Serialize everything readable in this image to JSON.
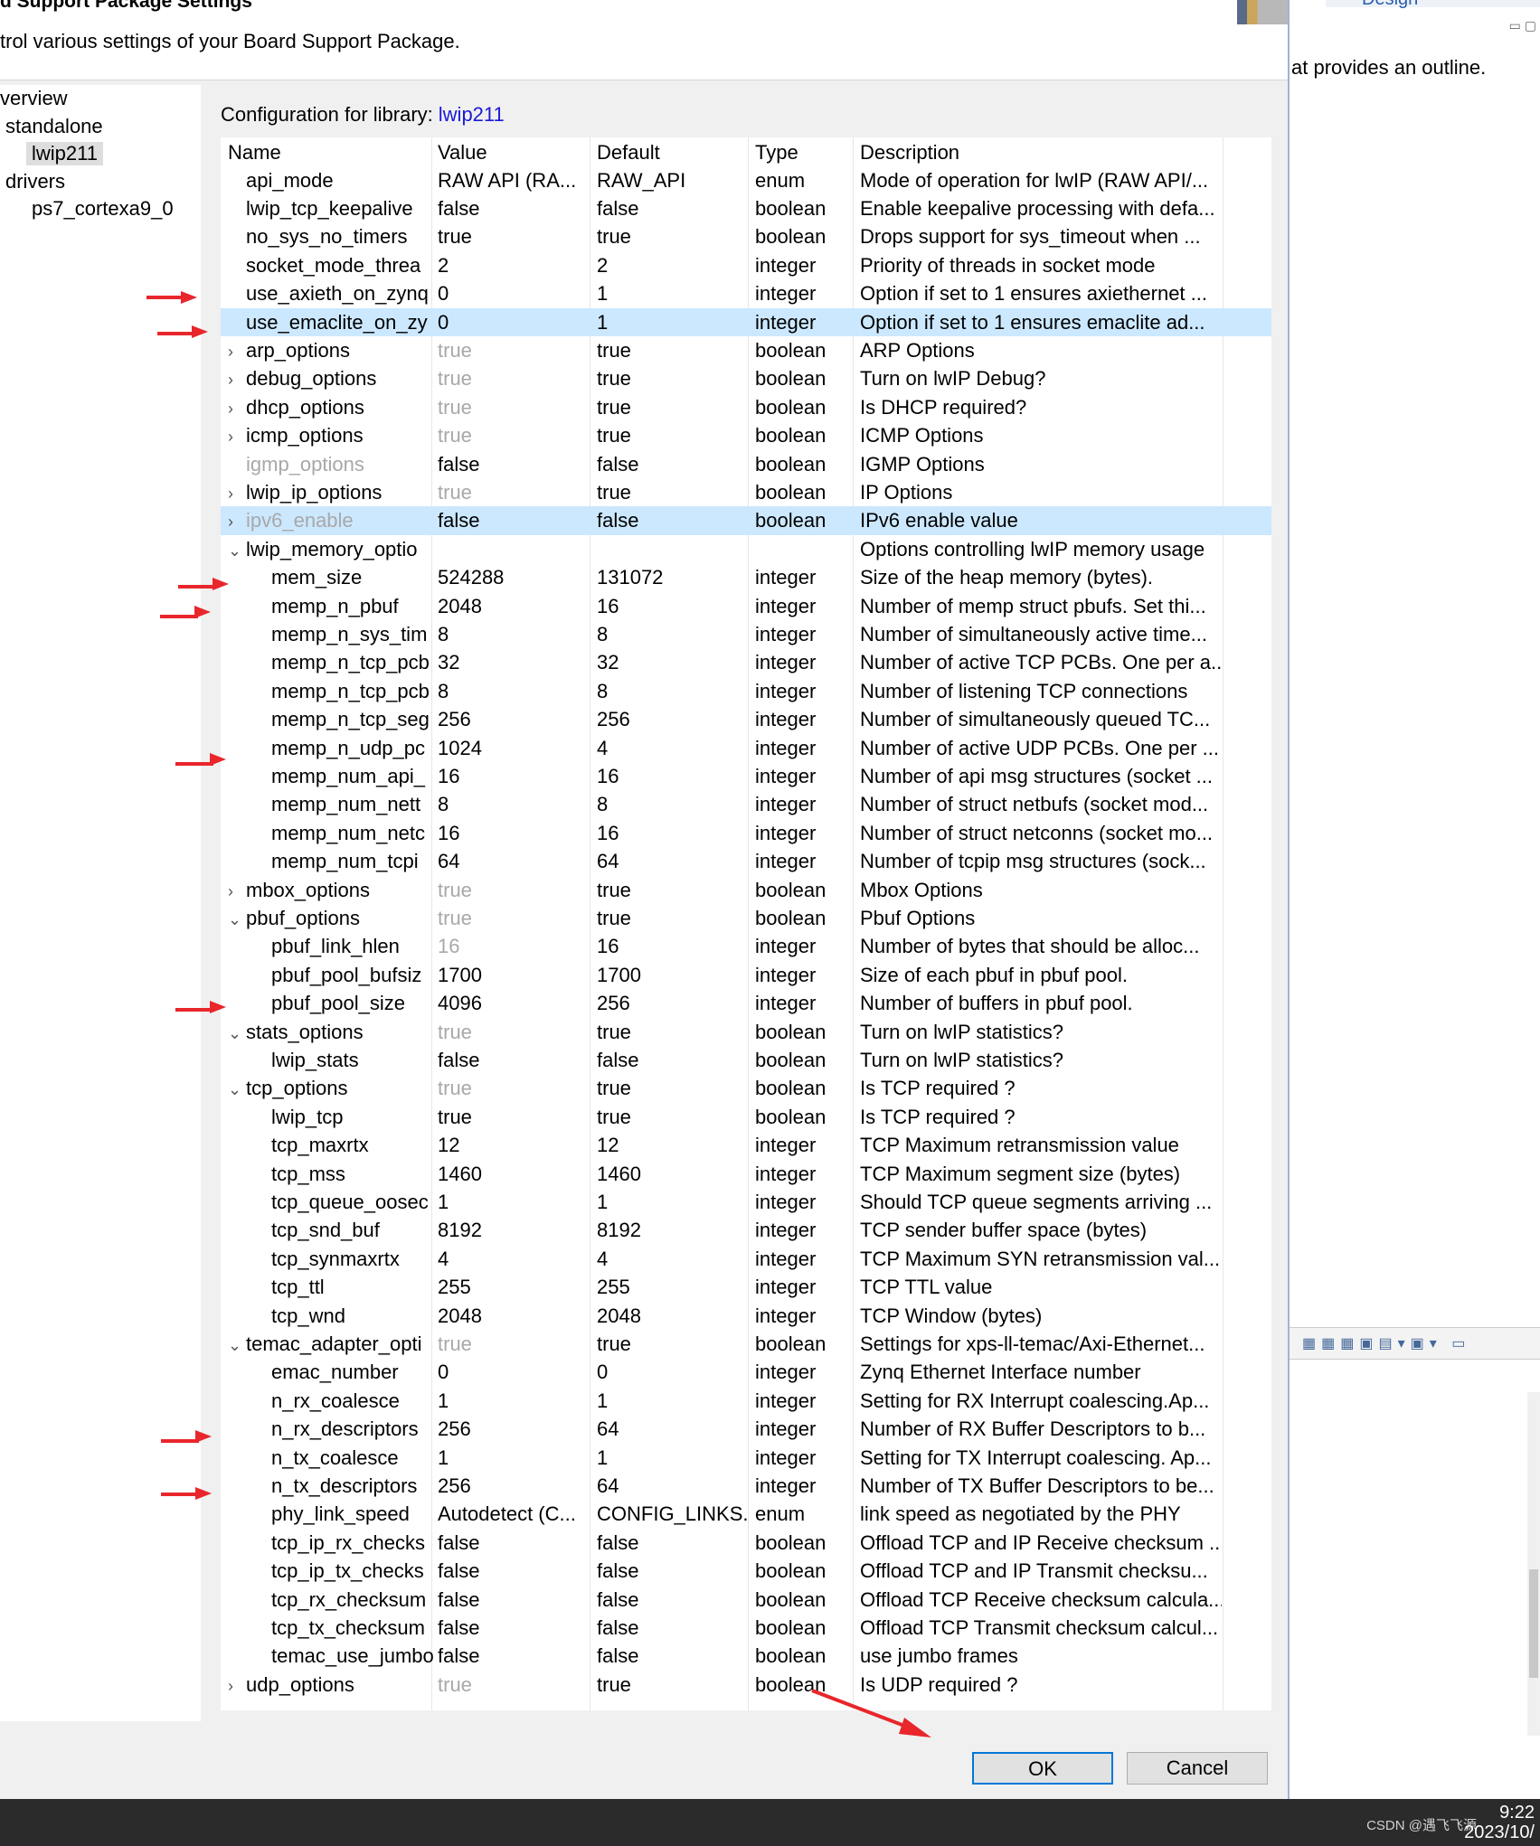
{
  "dialog": {
    "title": "d Support Package Settings",
    "subtitle": "trol various settings of your Board Support Package."
  },
  "tree": {
    "items": [
      {
        "label": "verview"
      },
      {
        "label": "standalone"
      },
      {
        "label": "lwip211"
      },
      {
        "label": "drivers"
      },
      {
        "label": "ps7_cortexa9_0"
      }
    ]
  },
  "config": {
    "label": "Configuration for library:",
    "library": "lwip211"
  },
  "table": {
    "headers": [
      "Name",
      "Value",
      "Default",
      "Type",
      "Description"
    ],
    "rows": [
      {
        "name": "api_mode",
        "value": "RAW API (RA...",
        "default": "RAW_API",
        "type": "enum",
        "desc": "Mode of operation for lwIP (RAW API/..."
      },
      {
        "name": "lwip_tcp_keepalive",
        "value": "false",
        "default": "false",
        "type": "boolean",
        "desc": "Enable keepalive processing with defa..."
      },
      {
        "name": "no_sys_no_timers",
        "value": "true",
        "default": "true",
        "type": "boolean",
        "desc": "Drops support for sys_timeout when ..."
      },
      {
        "name": "socket_mode_threa",
        "value": "2",
        "default": "2",
        "type": "integer",
        "desc": "Priority of threads in socket mode"
      },
      {
        "name": "use_axieth_on_zynq",
        "value": "0",
        "default": "1",
        "type": "integer",
        "desc": "Option if set to 1 ensures axiethernet ..."
      },
      {
        "name": "use_emaclite_on_zy",
        "value": "0",
        "default": "1",
        "type": "integer",
        "desc": "Option if set to 1 ensures emaclite ad..."
      },
      {
        "name": "arp_options",
        "value": "true",
        "default": "true",
        "type": "boolean",
        "desc": "ARP Options"
      },
      {
        "name": "debug_options",
        "value": "true",
        "default": "true",
        "type": "boolean",
        "desc": "Turn on lwIP Debug?"
      },
      {
        "name": "dhcp_options",
        "value": "true",
        "default": "true",
        "type": "boolean",
        "desc": "Is DHCP required?"
      },
      {
        "name": "icmp_options",
        "value": "true",
        "default": "true",
        "type": "boolean",
        "desc": "ICMP Options"
      },
      {
        "name": "igmp_options",
        "value": "false",
        "default": "false",
        "type": "boolean",
        "desc": "IGMP Options"
      },
      {
        "name": "lwip_ip_options",
        "value": "true",
        "default": "true",
        "type": "boolean",
        "desc": "IP Options"
      },
      {
        "name": "ipv6_enable",
        "value": "false",
        "default": "false",
        "type": "boolean",
        "desc": "IPv6 enable value"
      },
      {
        "name": "lwip_memory_optio",
        "value": "",
        "default": "",
        "type": "",
        "desc": "Options controlling lwIP memory usage"
      },
      {
        "name": "mem_size",
        "value": "524288",
        "default": "131072",
        "type": "integer",
        "desc": "Size of the heap memory (bytes)."
      },
      {
        "name": "memp_n_pbuf",
        "value": "2048",
        "default": "16",
        "type": "integer",
        "desc": "Number of memp struct pbufs. Set thi..."
      },
      {
        "name": "memp_n_sys_tim",
        "value": "8",
        "default": "8",
        "type": "integer",
        "desc": "Number of simultaneously active time..."
      },
      {
        "name": "memp_n_tcp_pcb",
        "value": "32",
        "default": "32",
        "type": "integer",
        "desc": "Number of active TCP PCBs. One per a..."
      },
      {
        "name": "memp_n_tcp_pcb",
        "value": "8",
        "default": "8",
        "type": "integer",
        "desc": "Number of listening TCP connections"
      },
      {
        "name": "memp_n_tcp_seg",
        "value": "256",
        "default": "256",
        "type": "integer",
        "desc": "Number of simultaneously queued TC..."
      },
      {
        "name": "memp_n_udp_pc",
        "value": "1024",
        "default": "4",
        "type": "integer",
        "desc": "Number of active UDP PCBs. One per ..."
      },
      {
        "name": "memp_num_api_",
        "value": "16",
        "default": "16",
        "type": "integer",
        "desc": "Number of api msg structures (socket ..."
      },
      {
        "name": "memp_num_nett",
        "value": "8",
        "default": "8",
        "type": "integer",
        "desc": "Number of struct netbufs (socket mod..."
      },
      {
        "name": "memp_num_netc",
        "value": "16",
        "default": "16",
        "type": "integer",
        "desc": "Number of struct netconns (socket mo..."
      },
      {
        "name": "memp_num_tcpi",
        "value": "64",
        "default": "64",
        "type": "integer",
        "desc": "Number of tcpip msg structures (sock..."
      },
      {
        "name": "mbox_options",
        "value": "true",
        "default": "true",
        "type": "boolean",
        "desc": "Mbox Options"
      },
      {
        "name": "pbuf_options",
        "value": "true",
        "default": "true",
        "type": "boolean",
        "desc": "Pbuf Options"
      },
      {
        "name": "pbuf_link_hlen",
        "value": "16",
        "default": "16",
        "type": "integer",
        "desc": "Number of bytes that should be alloc..."
      },
      {
        "name": "pbuf_pool_bufsiz",
        "value": "1700",
        "default": "1700",
        "type": "integer",
        "desc": "Size of each pbuf in pbuf pool."
      },
      {
        "name": "pbuf_pool_size",
        "value": "4096",
        "default": "256",
        "type": "integer",
        "desc": "Number of buffers in pbuf pool."
      },
      {
        "name": "stats_options",
        "value": "true",
        "default": "true",
        "type": "boolean",
        "desc": "Turn on lwIP statistics?"
      },
      {
        "name": "lwip_stats",
        "value": "false",
        "default": "false",
        "type": "boolean",
        "desc": "Turn on lwIP statistics?"
      },
      {
        "name": "tcp_options",
        "value": "true",
        "default": "true",
        "type": "boolean",
        "desc": "Is TCP required ?"
      },
      {
        "name": "lwip_tcp",
        "value": "true",
        "default": "true",
        "type": "boolean",
        "desc": "Is TCP required ?"
      },
      {
        "name": "tcp_maxrtx",
        "value": "12",
        "default": "12",
        "type": "integer",
        "desc": "TCP Maximum retransmission value"
      },
      {
        "name": "tcp_mss",
        "value": "1460",
        "default": "1460",
        "type": "integer",
        "desc": "TCP Maximum segment size (bytes)"
      },
      {
        "name": "tcp_queue_oosec",
        "value": "1",
        "default": "1",
        "type": "integer",
        "desc": "Should TCP queue segments arriving ..."
      },
      {
        "name": "tcp_snd_buf",
        "value": "8192",
        "default": "8192",
        "type": "integer",
        "desc": "TCP sender buffer space (bytes)"
      },
      {
        "name": "tcp_synmaxrtx",
        "value": "4",
        "default": "4",
        "type": "integer",
        "desc": "TCP Maximum SYN retransmission val..."
      },
      {
        "name": "tcp_ttl",
        "value": "255",
        "default": "255",
        "type": "integer",
        "desc": "TCP TTL value"
      },
      {
        "name": "tcp_wnd",
        "value": "2048",
        "default": "2048",
        "type": "integer",
        "desc": "TCP Window (bytes)"
      },
      {
        "name": "temac_adapter_opti",
        "value": "true",
        "default": "true",
        "type": "boolean",
        "desc": "Settings for xps-ll-temac/Axi-Ethernet..."
      },
      {
        "name": "emac_number",
        "value": "0",
        "default": "0",
        "type": "integer",
        "desc": "Zynq Ethernet Interface number"
      },
      {
        "name": "n_rx_coalesce",
        "value": "1",
        "default": "1",
        "type": "integer",
        "desc": "Setting for RX Interrupt coalescing.Ap..."
      },
      {
        "name": "n_rx_descriptors",
        "value": "256",
        "default": "64",
        "type": "integer",
        "desc": "Number of RX Buffer Descriptors to b..."
      },
      {
        "name": "n_tx_coalesce",
        "value": "1",
        "default": "1",
        "type": "integer",
        "desc": "Setting for TX Interrupt coalescing. Ap..."
      },
      {
        "name": "n_tx_descriptors",
        "value": "256",
        "default": "64",
        "type": "integer",
        "desc": "Number of TX Buffer Descriptors to be..."
      },
      {
        "name": "phy_link_speed",
        "value": "Autodetect (C...",
        "default": "CONFIG_LINKS...",
        "type": "enum",
        "desc": "link speed as negotiated by the PHY"
      },
      {
        "name": "tcp_ip_rx_checks",
        "value": "false",
        "default": "false",
        "type": "boolean",
        "desc": "Offload TCP and IP Receive checksum ..."
      },
      {
        "name": "tcp_ip_tx_checks",
        "value": "false",
        "default": "false",
        "type": "boolean",
        "desc": "Offload TCP and IP Transmit checksu..."
      },
      {
        "name": "tcp_rx_checksum",
        "value": "false",
        "default": "false",
        "type": "boolean",
        "desc": "Offload TCP Receive checksum calcula..."
      },
      {
        "name": "tcp_tx_checksum",
        "value": "false",
        "default": "false",
        "type": "boolean",
        "desc": "Offload TCP Transmit checksum calcul..."
      },
      {
        "name": "temac_use_jumbo",
        "value": "false",
        "default": "false",
        "type": "boolean",
        "desc": "use jumbo frames"
      },
      {
        "name": "udp_options",
        "value": "true",
        "default": "true",
        "type": "boolean",
        "desc": "Is UDP required ?"
      }
    ]
  },
  "buttons": {
    "ok": "OK",
    "cancel": "Cancel"
  },
  "right_pane": {
    "design_tab": "Design",
    "outline_text": "at provides an outline."
  },
  "taskbar": {
    "time": "9:22",
    "date": "2023/10/",
    "watermark": "CSDN @遇飞飞源"
  },
  "colors": {
    "accent": "#0078d7",
    "selection": "#cce8ff",
    "link": "#1a1ad6",
    "annotation_arrow": "#e8262b"
  }
}
